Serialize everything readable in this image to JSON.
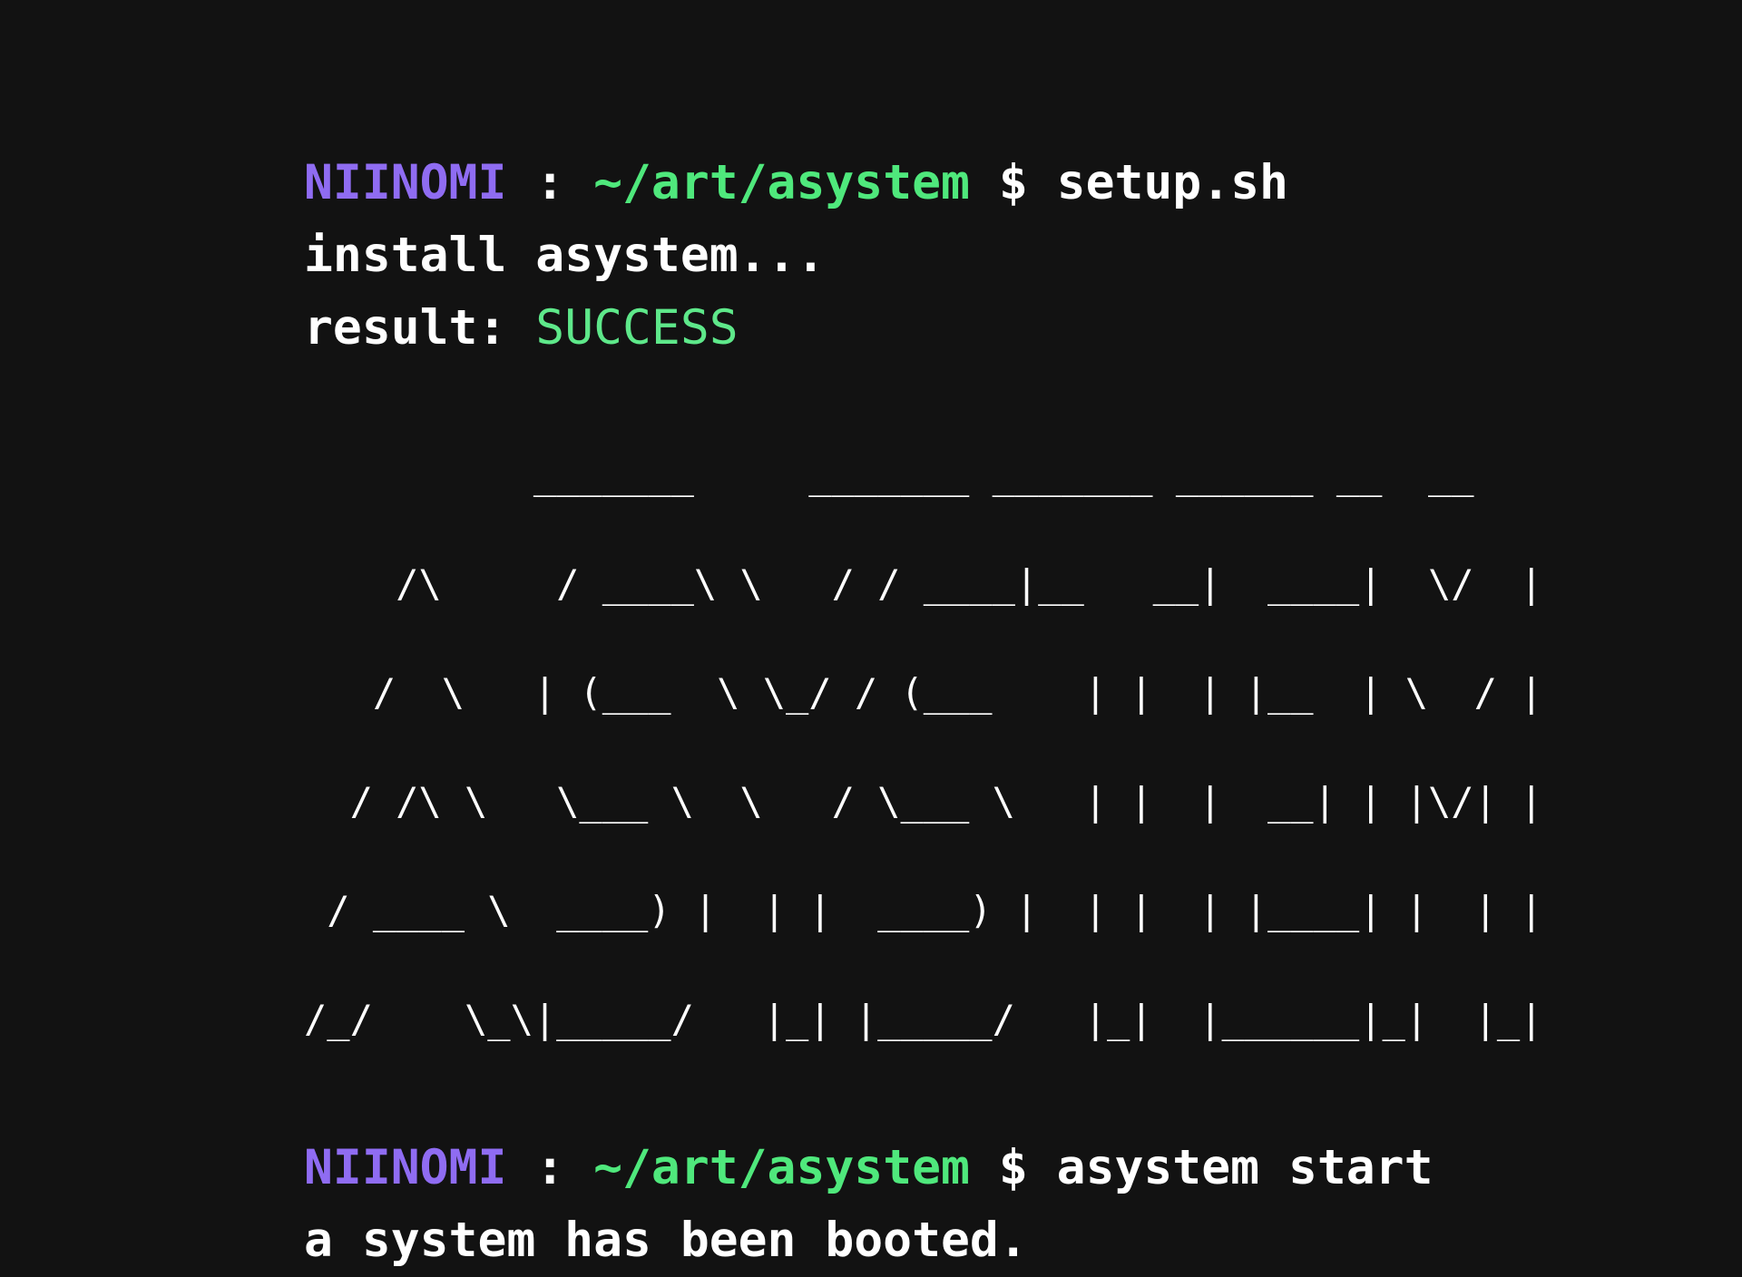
{
  "prompt": {
    "user": "NIINOMI",
    "sep": " : ",
    "path": "~/art/asystem",
    "dollar": " $ "
  },
  "commands": [
    "setup.sh",
    "asystem start"
  ],
  "outputs": {
    "install": "install asystem...",
    "result_label": "result: ",
    "result_value": "SUCCESS",
    "booted": "a system has been booted."
  },
  "ascii_art": [
    "          _______     _______ _______ ______ __  __",
    "    /\\     / ____\\ \\   / / ____|__   __|  ____|  \\/  |",
    "   /  \\   | (___  \\ \\_/ / (___    | |  | |__  | \\  / |",
    "  / /\\ \\   \\___ \\  \\   / \\___ \\   | |  |  __| | |\\/| |",
    " / ____ \\  ____) |  | |  ____) |  | |  | |____| |  | |",
    "/_/    \\_\\|_____/   |_| |_____/   |_|  |______|_|  |_|"
  ],
  "colors": {
    "background": "#121212",
    "user": "#8f6cf2",
    "path": "#4fe87c",
    "text": "#ffffff",
    "success": "#5ee88a"
  }
}
